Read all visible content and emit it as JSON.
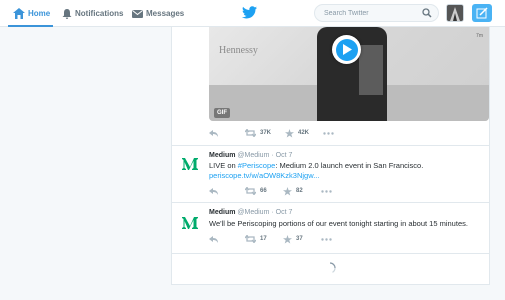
{
  "nav": {
    "home_label": "Home",
    "notifications_label": "Notifications",
    "messages_label": "Messages",
    "search_placeholder": "Search Twitter"
  },
  "colors": {
    "accent": "#1da1f2",
    "home_active": "#3b94d9",
    "medium_green": "#00ab6c"
  },
  "tweets": [
    {
      "media": {
        "overlay_text": "Hennessy",
        "badge": "GIF",
        "corner_tag": "7m"
      },
      "actions": {
        "retweets": "37K",
        "likes": "42K"
      }
    },
    {
      "name": "Medium",
      "handle": "@Medium",
      "sep": " · ",
      "date": "Oct 7",
      "text_before": "LIVE on ",
      "hashtag": "#Periscope",
      "text_middle": ": Medium 2.0 launch event in San Francisco. ",
      "link": "periscope.tv/w/aOW8Kzk3Njgw...",
      "actions": {
        "retweets": "66",
        "likes": "82"
      }
    },
    {
      "name": "Medium",
      "handle": "@Medium",
      "sep": " · ",
      "date": "Oct 7",
      "text": "We'll be Periscoping portions of our event tonight starting in about 15 minutes.",
      "actions": {
        "retweets": "17",
        "likes": "37"
      }
    }
  ]
}
